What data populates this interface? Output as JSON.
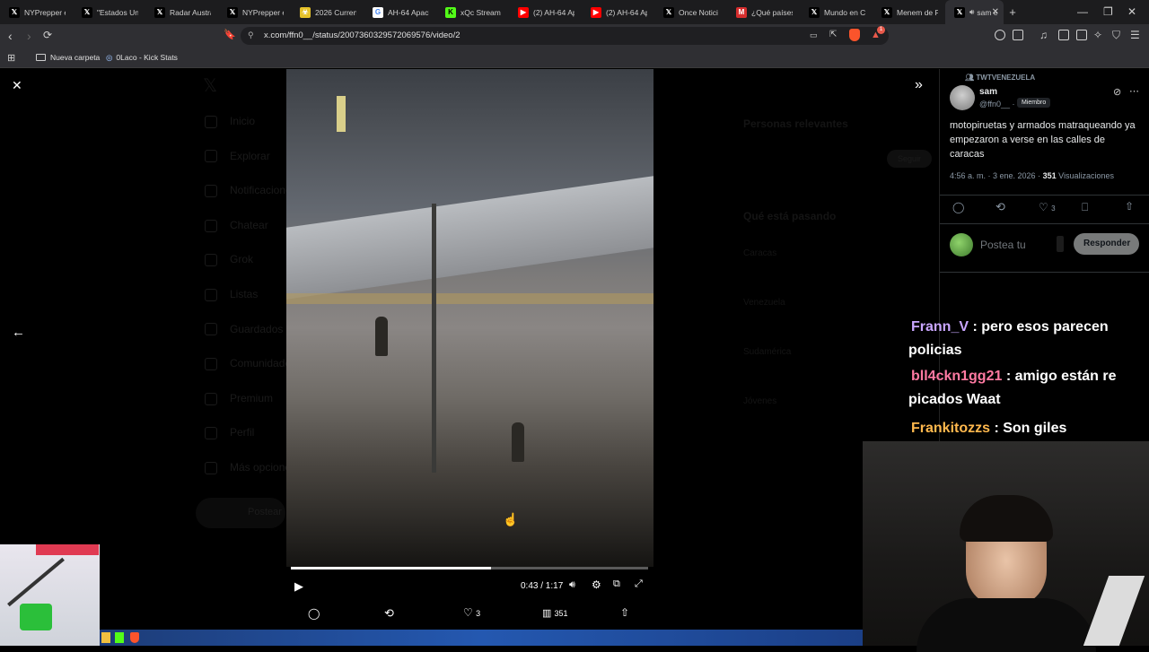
{
  "tabs": [
    {
      "label": "NYPrepper e",
      "icon": "x-logo-icon"
    },
    {
      "label": "\"Estados Unic",
      "icon": "x-logo-icon"
    },
    {
      "label": "Radar Austra",
      "icon": "x-logo-icon"
    },
    {
      "label": "NYPrepper e",
      "icon": "x-logo-icon"
    },
    {
      "label": "2026 Current",
      "icon": "biohazard-icon"
    },
    {
      "label": "AH-64 Apach",
      "icon": "google-icon"
    },
    {
      "label": "xQc Stream -",
      "icon": "kick-icon"
    },
    {
      "label": "(2) AH-64 Ap",
      "icon": "youtube-icon"
    },
    {
      "label": "(2) AH-64 Ap",
      "icon": "youtube-icon"
    },
    {
      "label": "Once Notici",
      "icon": "x-logo-icon"
    },
    {
      "label": "¿Qué países s",
      "icon": "m-icon"
    },
    {
      "label": "Mundo en Co",
      "icon": "x-logo-icon"
    },
    {
      "label": "Menem de R",
      "icon": "x-logo-icon"
    },
    {
      "label": "sam e",
      "icon": "x-logo-icon",
      "active": true
    }
  ],
  "address": {
    "url": "x.com/ffn0__/status/2007360329572069576/video/2",
    "shield_badge": "1"
  },
  "bookmarks": [
    {
      "label": "Nueva carpeta",
      "icon": "folder-icon"
    },
    {
      "label": "0Laco - Kick Stats",
      "icon": "link-icon"
    }
  ],
  "background_nav": [
    "Inicio",
    "Explorar",
    "Notificaciones",
    "Chatear",
    "Grok",
    "Listas",
    "Guardados",
    "Comunidades",
    "Premium",
    "Perfil",
    "Más opciones"
  ],
  "background_post_button": "Postear",
  "background_right": {
    "relevant": "Personas relevantes",
    "trending": "Qué está pasando",
    "follow": "Seguir",
    "items": [
      "Caracas",
      "Venezuela",
      "Sudamérica",
      "Jóvenes"
    ]
  },
  "video": {
    "time": "0:43 / 1:17",
    "progress": 0.56
  },
  "video_actions": {
    "likes": "3",
    "views": "351"
  },
  "tweet": {
    "community": "TWTVENEZUELA",
    "name": "sam",
    "handle": "@ffn0__ ·",
    "badge": "Miembro",
    "text": "motopiruetas y armados matraqueando ya empezaron a verse en las calles de caracas",
    "time": "4:56 a. m. · 3 ene. 2026 ·",
    "views_count": "351",
    "views_label": "Visualizaciones",
    "likes": "3",
    "reply_placeholder": "Postea tu",
    "reply_button": "Responder"
  },
  "chat": [
    {
      "user": "Frann_V",
      "msg": "pero esos parecen policias",
      "color": "#c9a6ff"
    },
    {
      "user": "bll4ckn1gg21",
      "msg": "amigo están re picados Waat",
      "color": "#ff7aa2"
    },
    {
      "user": "Frankitozzs",
      "msg": "Son giles",
      "color": "#ffb84d"
    }
  ]
}
